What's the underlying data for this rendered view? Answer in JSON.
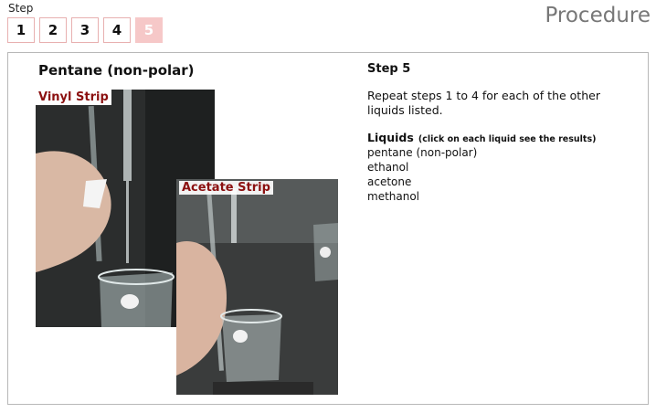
{
  "header": {
    "step_label": "Step",
    "page_title": "Procedure",
    "steps": [
      "1",
      "2",
      "3",
      "4",
      "5"
    ],
    "active_step": "5"
  },
  "main": {
    "liquid_title": "Pentane (non-polar)",
    "vinyl_label": "Vinyl Strip",
    "acetate_label": "Acetate Strip",
    "step_heading": "Step 5",
    "step_text": "Repeat steps 1 to 4 for each of the other liquids listed.",
    "liquids_heading": "Liquids",
    "liquids_hint": "(click on each liquid see the results)",
    "liquids": [
      "pentane (non-polar)",
      "ethanol",
      "acetone",
      "methanol"
    ]
  },
  "colors": {
    "accent_red": "#8b1010",
    "step_border": "#e8b0b0",
    "active_step_bg": "#f6c8c8",
    "title_gray": "#777777"
  }
}
